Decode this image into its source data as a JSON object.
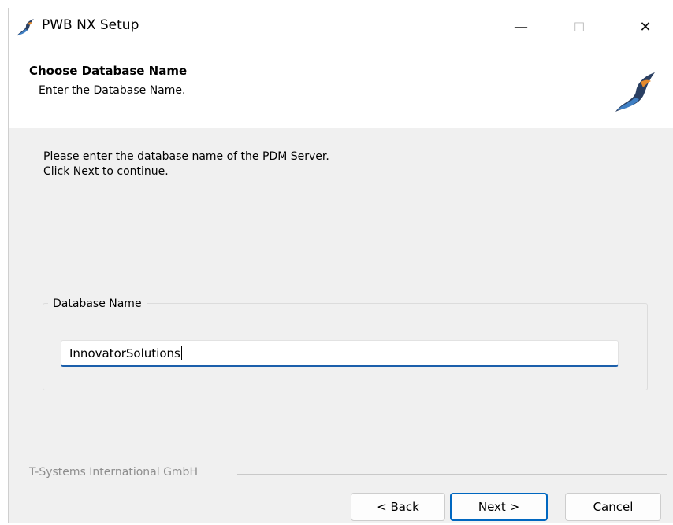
{
  "window": {
    "title": "PWB NX Setup",
    "minimize_glyph": "—",
    "maximize_glyph": "☐",
    "close_glyph": "✕",
    "app_icon": "pwb-nx-logo-icon"
  },
  "header": {
    "title": "Choose Database Name",
    "subtitle": "Enter the Database Name.",
    "logo_icon": "pwb-nx-logo-icon"
  },
  "body": {
    "line1": "Please enter the database name of the PDM Server.",
    "line2": "Click Next to continue."
  },
  "database_group": {
    "label": "Database Name",
    "input_value": "InnovatorSolutions"
  },
  "footer": {
    "brand": "T-Systems International GmbH",
    "back_label": "< Back",
    "next_label": "Next >",
    "cancel_label": "Cancel"
  },
  "colors": {
    "accent": "#0067c0",
    "logo_blue": "#3f7fc3",
    "logo_orange": "#e58a2c",
    "logo_dark": "#2a3f62"
  }
}
